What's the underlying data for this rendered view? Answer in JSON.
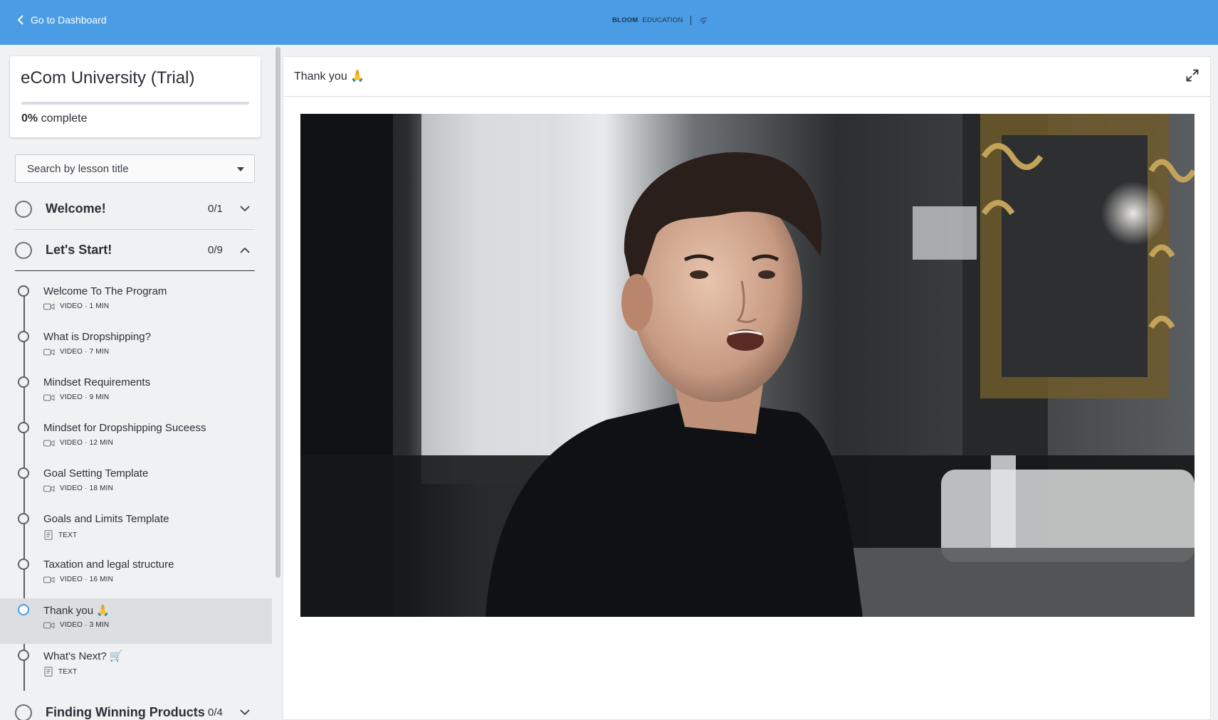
{
  "header": {
    "back_label": "Go to Dashboard",
    "brand_bold": "BLOOM",
    "brand_light": "EDUCATION"
  },
  "course": {
    "title": "eCom University (Trial)",
    "progress_percent": 0,
    "progress_value": "0%",
    "progress_suffix": " complete"
  },
  "search": {
    "placeholder": "Search by lesson title"
  },
  "sections": [
    {
      "title": "Welcome!",
      "count": "0/1",
      "expanded": false
    },
    {
      "title": "Let's Start!",
      "count": "0/9",
      "expanded": true
    },
    {
      "title": "Finding Winning Products",
      "count": "0/4",
      "expanded": false
    }
  ],
  "lessons": [
    {
      "title": "Welcome To The Program",
      "meta": "VIDEO · 1 MIN",
      "type": "video-icon"
    },
    {
      "title": "What is Dropshipping?",
      "meta": "VIDEO · 7 MIN",
      "type": "video-icon"
    },
    {
      "title": "Mindset Requirements",
      "meta": "VIDEO · 9 MIN",
      "type": "video-icon"
    },
    {
      "title": "Mindset for Dropshipping Suceess",
      "meta": "VIDEO · 12 MIN",
      "type": "video-icon"
    },
    {
      "title": "Goal Setting Template",
      "meta": "VIDEO · 18 MIN",
      "type": "video-icon"
    },
    {
      "title": "Goals and Limits Template",
      "meta": "TEXT",
      "type": "text-icon"
    },
    {
      "title": "Taxation and legal structure",
      "meta": "VIDEO · 16 MIN",
      "type": "video-icon"
    },
    {
      "title": "Thank you 🙏",
      "meta": "VIDEO · 3 MIN",
      "type": "video-icon",
      "active": true
    },
    {
      "title": "What's Next? 🛒",
      "meta": "TEXT",
      "type": "text-icon"
    }
  ],
  "main": {
    "lesson_title": "Thank you 🙏"
  },
  "colors": {
    "accent": "#4a9de4",
    "header_bg": "#4a9de4"
  }
}
